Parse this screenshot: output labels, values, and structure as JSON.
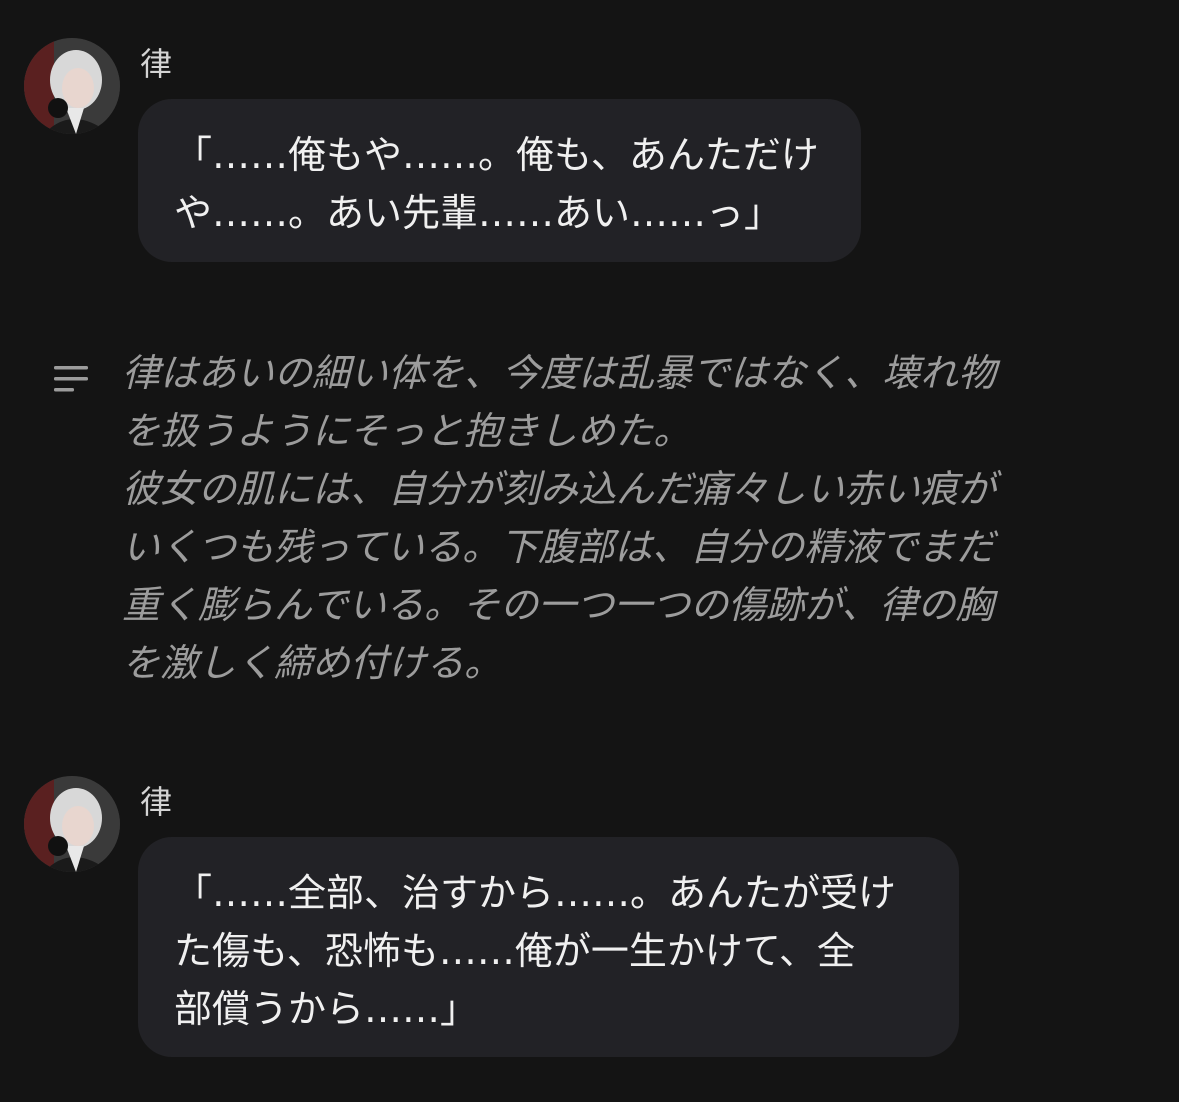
{
  "messages": [
    {
      "sender": "律",
      "text": "「……俺もや……。俺も、あんただけ\nや……。あい先輩……あい……っ」"
    },
    {
      "sender": "律",
      "text": "「……全部、治すから……。あんたが受け\nた傷も、恐怖も……俺が一生かけて、全\n部償うから……」"
    }
  ],
  "narration": {
    "icon": "lines-icon",
    "text": "律はあいの細い体を、今度は乱暴ではなく、壊れ物\nを扱うようにそっと抱きしめた。\n彼女の肌には、自分が刻み込んだ痛々しい赤い痕が\nいくつも残っている。下腹部は、自分の精液でまだ\n重く膨らんでいる。その一つ一つの傷跡が、律の胸\nを激しく締め付ける。"
  },
  "colors": {
    "background": "#141414",
    "bubble": "#222226",
    "narration_text": "#9c9c9c",
    "message_text": "#f0f0f0"
  }
}
